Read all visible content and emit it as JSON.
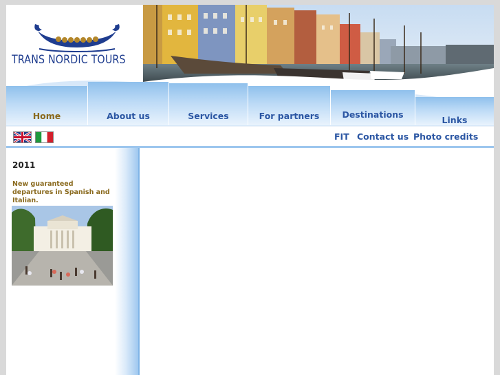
{
  "brand": {
    "name": "TRANS NORDIC TOURS"
  },
  "nav": {
    "items": [
      {
        "label": "Home"
      },
      {
        "label": "About us"
      },
      {
        "label": "Services"
      },
      {
        "label": "For partners"
      },
      {
        "label": "Destinations"
      },
      {
        "label": "Links"
      }
    ],
    "active_color": "#8a6a1e",
    "link_color": "#2b56a3"
  },
  "languages": [
    {
      "icon": "uk-flag-icon"
    },
    {
      "icon": "italy-flag-icon"
    }
  ],
  "sublinks": [
    {
      "label": "FIT"
    },
    {
      "label": "Contact us"
    },
    {
      "label": "Photo credits"
    }
  ],
  "sidebar": {
    "year": "2011",
    "news": "New guaranteed departures in Spanish and Italian."
  }
}
